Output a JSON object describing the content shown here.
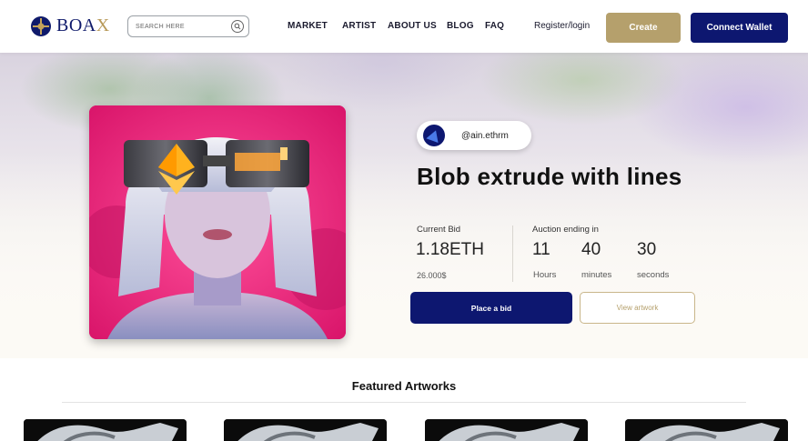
{
  "header": {
    "logo_text_main": "BOA",
    "logo_text_accent": "X",
    "search_placeholder": "SEARCH HERE",
    "nav": [
      "MARKET",
      "ARTIST",
      "ABOUT US",
      "BLOG",
      "FAQ"
    ],
    "register_label": "Register/login",
    "create_label": "Create",
    "connect_label": "Connect Wallet"
  },
  "hero": {
    "creator_handle": "@ain.ethrm",
    "title": "Blob extrude with lines",
    "current_bid_label": "Current Bid",
    "current_bid_value": "1.18ETH",
    "current_bid_usd": "26.000$",
    "auction_label": "Auction ending in",
    "countdown": [
      {
        "value": "11",
        "unit": "Hours"
      },
      {
        "value": "40",
        "unit": "minutes"
      },
      {
        "value": "30",
        "unit": "seconds"
      }
    ],
    "place_bid_label": "Place a bid",
    "view_artwork_label": "View artwork"
  },
  "featured": {
    "title": "Featured Artworks",
    "cards": 4
  },
  "colors": {
    "brand_navy": "#0d1770",
    "brand_gold": "#b5a06c",
    "artwork_pink": "#e91f74"
  },
  "icons": {
    "search": "search-icon",
    "logo": "compass-logo-icon"
  }
}
